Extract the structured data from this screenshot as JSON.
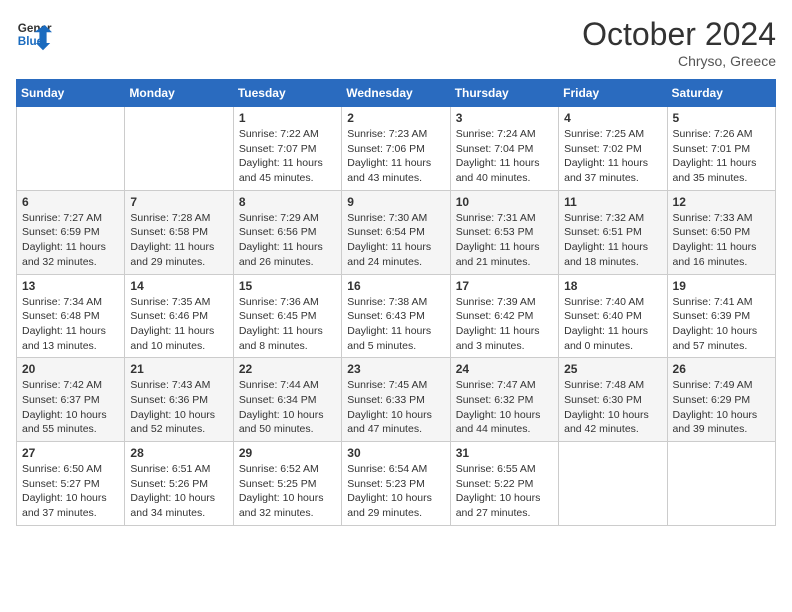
{
  "header": {
    "logo_line1": "General",
    "logo_line2": "Blue",
    "month": "October 2024",
    "location": "Chryso, Greece"
  },
  "days_of_week": [
    "Sunday",
    "Monday",
    "Tuesday",
    "Wednesday",
    "Thursday",
    "Friday",
    "Saturday"
  ],
  "weeks": [
    [
      {
        "day": "",
        "info": ""
      },
      {
        "day": "",
        "info": ""
      },
      {
        "day": "1",
        "info": "Sunrise: 7:22 AM\nSunset: 7:07 PM\nDaylight: 11 hours and 45 minutes."
      },
      {
        "day": "2",
        "info": "Sunrise: 7:23 AM\nSunset: 7:06 PM\nDaylight: 11 hours and 43 minutes."
      },
      {
        "day": "3",
        "info": "Sunrise: 7:24 AM\nSunset: 7:04 PM\nDaylight: 11 hours and 40 minutes."
      },
      {
        "day": "4",
        "info": "Sunrise: 7:25 AM\nSunset: 7:02 PM\nDaylight: 11 hours and 37 minutes."
      },
      {
        "day": "5",
        "info": "Sunrise: 7:26 AM\nSunset: 7:01 PM\nDaylight: 11 hours and 35 minutes."
      }
    ],
    [
      {
        "day": "6",
        "info": "Sunrise: 7:27 AM\nSunset: 6:59 PM\nDaylight: 11 hours and 32 minutes."
      },
      {
        "day": "7",
        "info": "Sunrise: 7:28 AM\nSunset: 6:58 PM\nDaylight: 11 hours and 29 minutes."
      },
      {
        "day": "8",
        "info": "Sunrise: 7:29 AM\nSunset: 6:56 PM\nDaylight: 11 hours and 26 minutes."
      },
      {
        "day": "9",
        "info": "Sunrise: 7:30 AM\nSunset: 6:54 PM\nDaylight: 11 hours and 24 minutes."
      },
      {
        "day": "10",
        "info": "Sunrise: 7:31 AM\nSunset: 6:53 PM\nDaylight: 11 hours and 21 minutes."
      },
      {
        "day": "11",
        "info": "Sunrise: 7:32 AM\nSunset: 6:51 PM\nDaylight: 11 hours and 18 minutes."
      },
      {
        "day": "12",
        "info": "Sunrise: 7:33 AM\nSunset: 6:50 PM\nDaylight: 11 hours and 16 minutes."
      }
    ],
    [
      {
        "day": "13",
        "info": "Sunrise: 7:34 AM\nSunset: 6:48 PM\nDaylight: 11 hours and 13 minutes."
      },
      {
        "day": "14",
        "info": "Sunrise: 7:35 AM\nSunset: 6:46 PM\nDaylight: 11 hours and 10 minutes."
      },
      {
        "day": "15",
        "info": "Sunrise: 7:36 AM\nSunset: 6:45 PM\nDaylight: 11 hours and 8 minutes."
      },
      {
        "day": "16",
        "info": "Sunrise: 7:38 AM\nSunset: 6:43 PM\nDaylight: 11 hours and 5 minutes."
      },
      {
        "day": "17",
        "info": "Sunrise: 7:39 AM\nSunset: 6:42 PM\nDaylight: 11 hours and 3 minutes."
      },
      {
        "day": "18",
        "info": "Sunrise: 7:40 AM\nSunset: 6:40 PM\nDaylight: 11 hours and 0 minutes."
      },
      {
        "day": "19",
        "info": "Sunrise: 7:41 AM\nSunset: 6:39 PM\nDaylight: 10 hours and 57 minutes."
      }
    ],
    [
      {
        "day": "20",
        "info": "Sunrise: 7:42 AM\nSunset: 6:37 PM\nDaylight: 10 hours and 55 minutes."
      },
      {
        "day": "21",
        "info": "Sunrise: 7:43 AM\nSunset: 6:36 PM\nDaylight: 10 hours and 52 minutes."
      },
      {
        "day": "22",
        "info": "Sunrise: 7:44 AM\nSunset: 6:34 PM\nDaylight: 10 hours and 50 minutes."
      },
      {
        "day": "23",
        "info": "Sunrise: 7:45 AM\nSunset: 6:33 PM\nDaylight: 10 hours and 47 minutes."
      },
      {
        "day": "24",
        "info": "Sunrise: 7:47 AM\nSunset: 6:32 PM\nDaylight: 10 hours and 44 minutes."
      },
      {
        "day": "25",
        "info": "Sunrise: 7:48 AM\nSunset: 6:30 PM\nDaylight: 10 hours and 42 minutes."
      },
      {
        "day": "26",
        "info": "Sunrise: 7:49 AM\nSunset: 6:29 PM\nDaylight: 10 hours and 39 minutes."
      }
    ],
    [
      {
        "day": "27",
        "info": "Sunrise: 6:50 AM\nSunset: 5:27 PM\nDaylight: 10 hours and 37 minutes."
      },
      {
        "day": "28",
        "info": "Sunrise: 6:51 AM\nSunset: 5:26 PM\nDaylight: 10 hours and 34 minutes."
      },
      {
        "day": "29",
        "info": "Sunrise: 6:52 AM\nSunset: 5:25 PM\nDaylight: 10 hours and 32 minutes."
      },
      {
        "day": "30",
        "info": "Sunrise: 6:54 AM\nSunset: 5:23 PM\nDaylight: 10 hours and 29 minutes."
      },
      {
        "day": "31",
        "info": "Sunrise: 6:55 AM\nSunset: 5:22 PM\nDaylight: 10 hours and 27 minutes."
      },
      {
        "day": "",
        "info": ""
      },
      {
        "day": "",
        "info": ""
      }
    ]
  ]
}
